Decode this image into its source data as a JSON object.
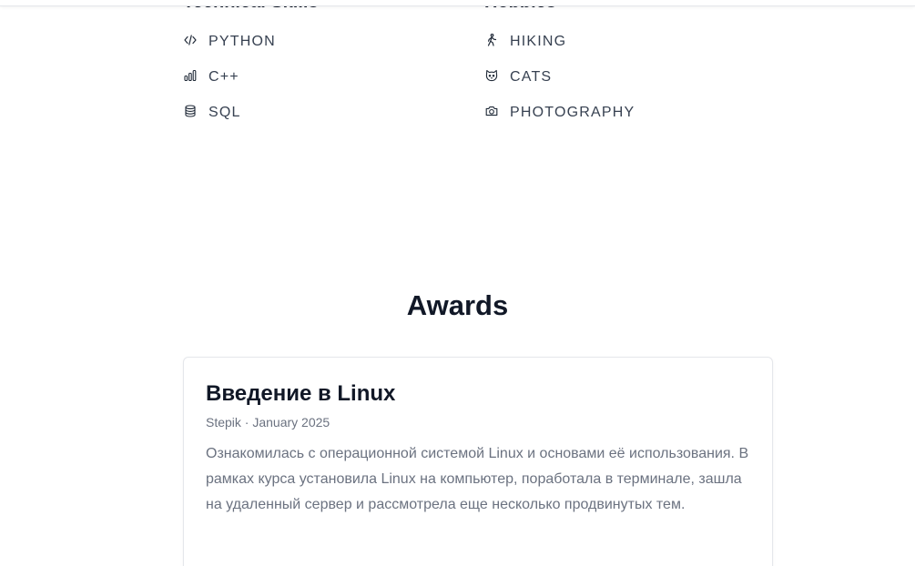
{
  "technical_skills": {
    "title": "Technical Skills",
    "items": [
      {
        "label": "PYTHON",
        "icon": "code-icon"
      },
      {
        "label": "C++",
        "icon": "bar-chart-icon"
      },
      {
        "label": "SQL",
        "icon": "database-icon"
      }
    ]
  },
  "hobbies": {
    "title": "Hobbies",
    "items": [
      {
        "label": "HIKING",
        "icon": "walking-icon"
      },
      {
        "label": "CATS",
        "icon": "cat-icon"
      },
      {
        "label": "PHOTOGRAPHY",
        "icon": "camera-icon"
      }
    ]
  },
  "awards": {
    "title": "Awards",
    "items": [
      {
        "title": "Введение в Linux",
        "meta": "Stepik · January 2025",
        "description": "Ознакомилась с операционной системой Linux и основами её использования. В рамках курса установила Linux на компьютер, поработала в терминале, зашла на удаленный сервер и рассмотрела еще несколько продвинутых тем."
      }
    ]
  }
}
